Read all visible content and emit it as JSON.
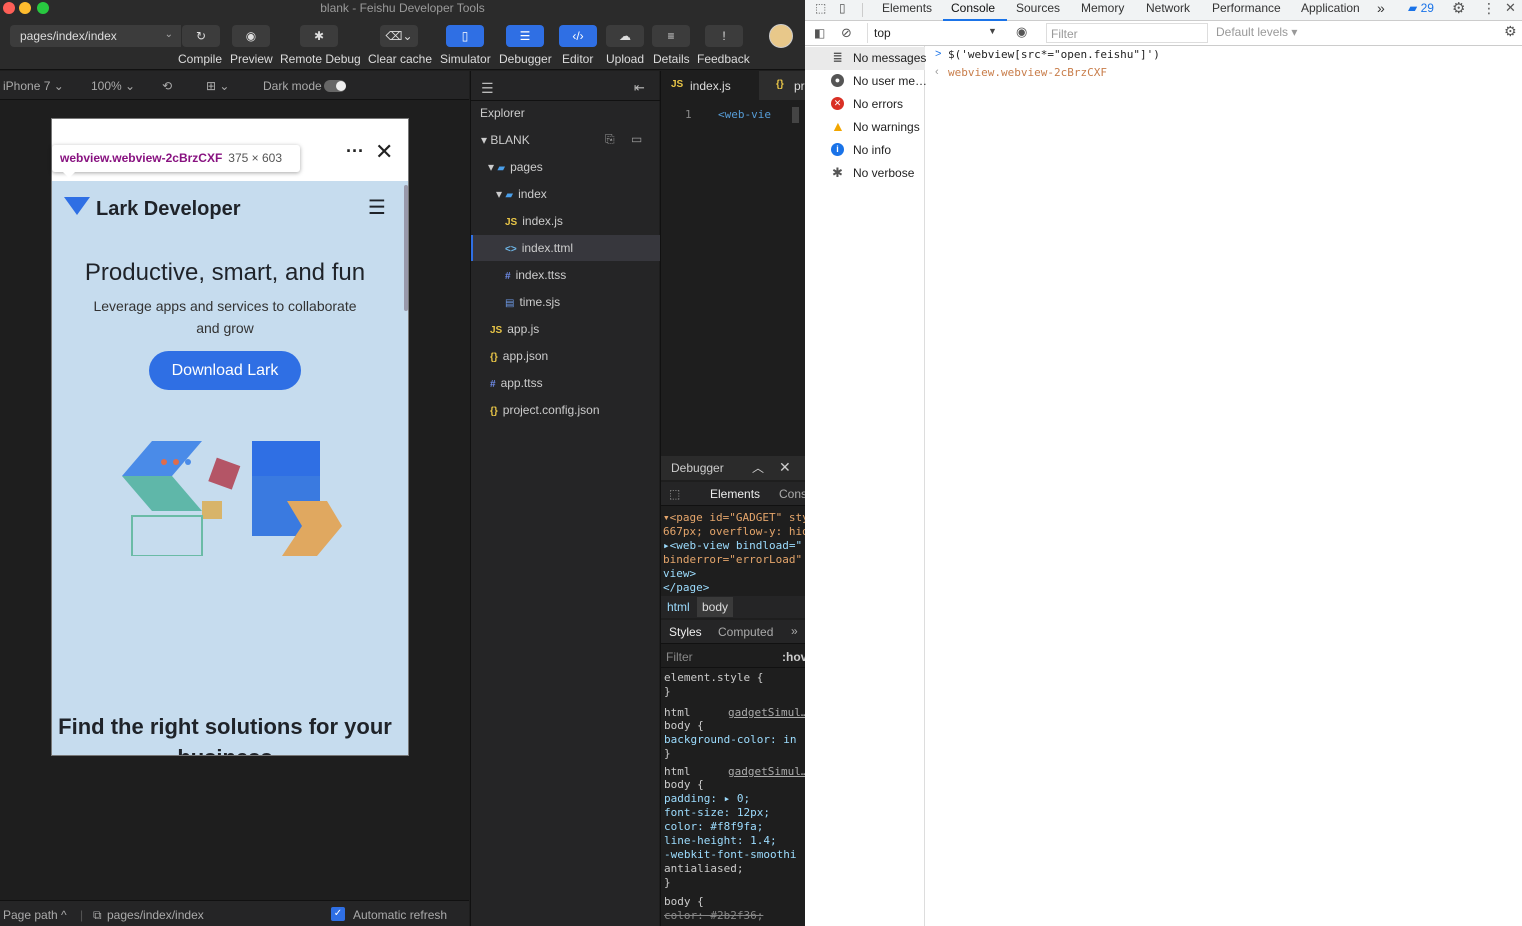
{
  "window": {
    "title": "blank - Feishu Developer Tools"
  },
  "toolbar": {
    "page_path": "pages/index/index",
    "buttons": [
      {
        "label": "Compile"
      },
      {
        "label": "Preview"
      },
      {
        "label": "Remote Debug"
      },
      {
        "label": "Clear cache"
      },
      {
        "label": "Simulator"
      },
      {
        "label": "Debugger"
      },
      {
        "label": "Editor"
      },
      {
        "label": "Upload"
      },
      {
        "label": "Details"
      },
      {
        "label": "Feedback"
      }
    ]
  },
  "simulator_bar": {
    "device": "iPhone 7",
    "zoom": "100%",
    "dark_mode": "Dark mode"
  },
  "phone": {
    "tooltip_name": "webview.webview-2cBrzCXF",
    "tooltip_size": "375 × 603",
    "brand": "Lark Developer",
    "headline": "Productive, smart, and fun",
    "subline": "Leverage apps and services to collaborate and grow",
    "cta": "Download Lark",
    "section2": "Find the right solutions for your business"
  },
  "status": {
    "page_path_label": "Page path",
    "current_path": "pages/index/index",
    "auto_refresh": "Automatic refresh"
  },
  "explorer": {
    "title": "Explorer",
    "project": "BLANK",
    "items": [
      {
        "label": "pages",
        "icon": "folder-icon"
      },
      {
        "label": "index",
        "icon": "folder-icon"
      },
      {
        "label": "index.js",
        "icon": "JS"
      },
      {
        "label": "index.ttml",
        "icon": "<>"
      },
      {
        "label": "index.ttss",
        "icon": "#"
      },
      {
        "label": "time.sjs",
        "icon": "file-icon"
      },
      {
        "label": "app.js",
        "icon": "JS"
      },
      {
        "label": "app.json",
        "icon": "{}"
      },
      {
        "label": "app.ttss",
        "icon": "#"
      },
      {
        "label": "project.config.json",
        "icon": "{}"
      }
    ]
  },
  "editor": {
    "tab1": "index.js",
    "tab2": "pr",
    "line_no": "1",
    "line1": "<web-vie"
  },
  "debugger": {
    "title": "Debugger",
    "tabs": [
      "Elements",
      "Cons"
    ],
    "dom": [
      "▾<page id=\"GADGET\" sty",
      "667px; overflow-y: hid",
      "  ▸<web-view bindload=\"",
      "  binderror=\"errorLoad\"",
      "  view>",
      "  </page>"
    ],
    "crumbs": [
      "html",
      "body"
    ],
    "style_tabs": [
      "Styles",
      "Computed"
    ],
    "filter": "Filter",
    "hov": ":hov",
    "css": [
      "element.style {",
      "}",
      "html",
      "body {",
      "  background-color: in",
      "}",
      "html",
      "body {",
      "  padding: ▸ 0;",
      "  font-size: 12px;",
      "  color: #f8f9fa;",
      "  line-height: 1.4;",
      "  -webkit-font-smoothi",
      "    antialiased;",
      "}",
      "body {",
      "  color: #2b2f36;"
    ],
    "source1": "gadgetSimul…",
    "source2": "gadgetSimul…"
  },
  "devtools": {
    "tabs": [
      "Elements",
      "Console",
      "Sources",
      "Memory",
      "Network",
      "Performance",
      "Application"
    ],
    "more": "»",
    "badge": "29",
    "context": "top",
    "filter_placeholder": "Filter",
    "levels": "Default levels ▾",
    "sidebar": [
      {
        "label": "No messages",
        "icon": "list-icon"
      },
      {
        "label": "No user me…",
        "icon": "user-icon"
      },
      {
        "label": "No errors",
        "icon": "error-icon"
      },
      {
        "label": "No warnings",
        "icon": "warning-icon"
      },
      {
        "label": "No info",
        "icon": "info-icon"
      },
      {
        "label": "No verbose",
        "icon": "bug-icon"
      }
    ],
    "console_input": "$('webview[src*=\"open.feishu\"]')",
    "console_output": "webview.webview-2cBrzCXF"
  },
  "colors": {
    "accent": "#2f6fe4",
    "tag": "#881280",
    "phone_bg": "#c6dcee"
  }
}
